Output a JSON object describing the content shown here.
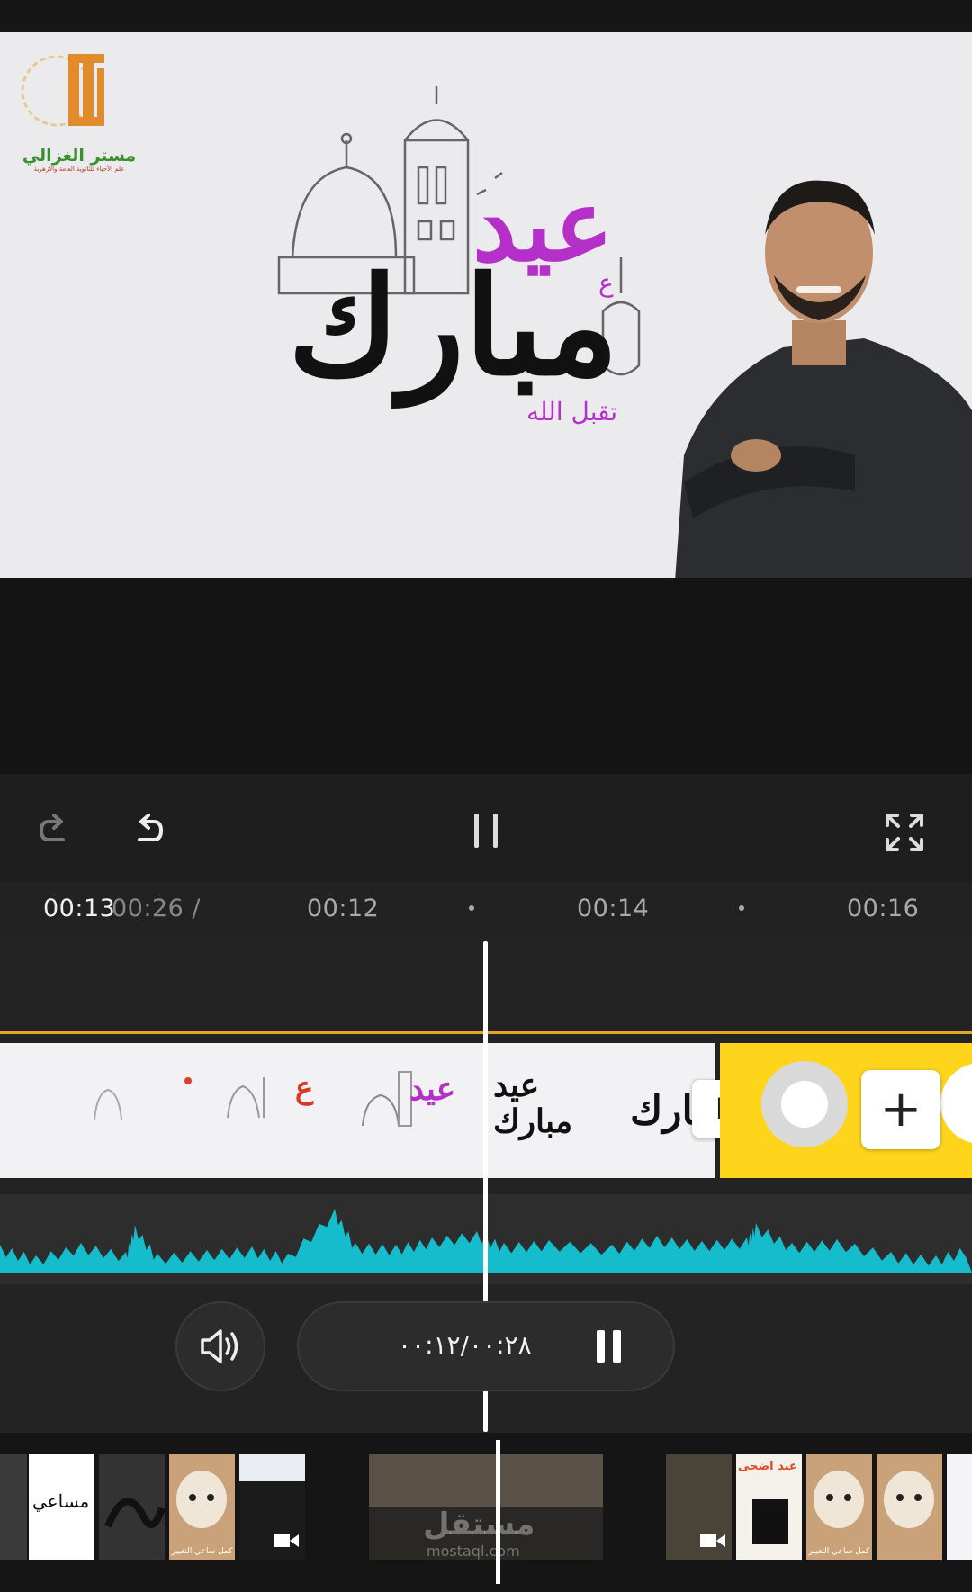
{
  "preview": {
    "logo_name": "مستر الغزالي",
    "logo_tagline": "علم الأحياء للثانوية العامة والأزهرية",
    "greeting_top": "عيد",
    "greeting_main": "مبارك",
    "greeting_small": "تقبل الله",
    "greeting_minor": "ع"
  },
  "toolbar": {
    "redo_icon": "redo-icon",
    "undo_icon": "undo-icon",
    "pause_icon": "pause-icon",
    "fullscreen_icon": "fullscreen-icon"
  },
  "ruler": {
    "current_time": "00:13",
    "total_time": "00:26 /",
    "marks": [
      "00:12",
      "00:14",
      "00:16"
    ]
  },
  "clips": {
    "frame_greetings": [
      "ع",
      "عيد",
      "عيد مبارك",
      "مبارك"
    ],
    "trim_handle_label": "I",
    "add_button_label": "+"
  },
  "playback": {
    "time_display": "٠٠:١٢/٠٠:٢٨",
    "volume_icon": "volume-icon",
    "pause_icon": "pause-icon"
  },
  "thumbnails": {
    "watermark": "مستقل",
    "watermark_url": "mostaql.com",
    "labels": [
      "مساعي",
      "كمل ساعي التغيير",
      "كمل ساعي التغيير",
      "عيد اضحى"
    ]
  },
  "colors": {
    "accent_orange": "#e1a52a",
    "waveform": "#14bccc",
    "yellow_clip": "#ffd51c",
    "greeting_purple": "#b530c8"
  }
}
